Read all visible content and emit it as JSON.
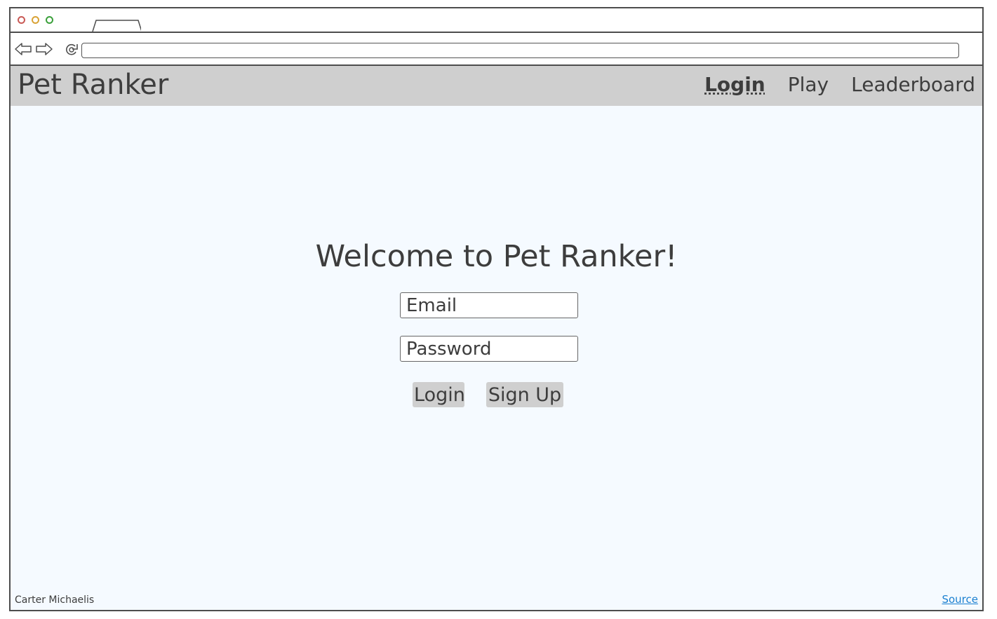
{
  "browser": {
    "window_controls": [
      "close-dot",
      "minimize-dot",
      "maximize-dot"
    ],
    "address_value": ""
  },
  "header": {
    "brand": "Pet Ranker",
    "nav": [
      {
        "label": "Login",
        "active": true
      },
      {
        "label": "Play",
        "active": false
      },
      {
        "label": "Leaderboard",
        "active": false
      }
    ]
  },
  "login": {
    "welcome": "Welcome to Pet Ranker!",
    "email_placeholder": "Email",
    "password_placeholder": "Password",
    "login_button": "Login",
    "signup_button": "Sign Up"
  },
  "footer": {
    "author": "Carter Michaelis",
    "source_link": "Source"
  },
  "colors": {
    "appbar": "#cfcfcf",
    "page_background": "#f5faff",
    "text": "#3d3d3d",
    "link": "#1a7fd0"
  }
}
